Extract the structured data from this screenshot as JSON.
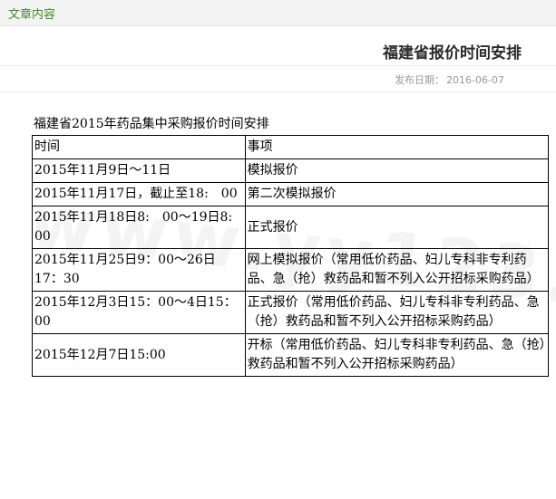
{
  "header": {
    "section_label": "文章内容"
  },
  "article": {
    "title": "福建省报价时间安排",
    "date_label": "发布日期：",
    "date_value": "2016-06-07",
    "heading": "福建省2015年药品集中采购报价时间安排",
    "watermark": "www.yy123.com"
  },
  "table": {
    "headers": [
      "时间",
      "事项"
    ],
    "rows": [
      {
        "time": "2015年11月9日～11日",
        "item": "模拟报价"
      },
      {
        "time": "2015年11月17日，截止至18:　00",
        "item": "第二次模拟报价"
      },
      {
        "time": "2015年11月18日8:　00～19日8:　00",
        "item": "正式报价"
      },
      {
        "time": "2015年11月25日9：00～26日17：30",
        "item": "网上模拟报价（常用低价药品、妇儿专科非专利药品、急（抢）救药品和暂不列入公开招标采购药品）"
      },
      {
        "time": "2015年12月3日15：00～4日15：00",
        "item": "正式报价（常用低价药品、妇儿专科非专利药品、急（抢）救药品和暂不列入公开招标采购药品）"
      },
      {
        "time": "2015年12月7日15:00",
        "item": "开标（常用低价药品、妇儿专科非专利药品、急（抢）救药品和暂不列入公开招标采购药品）"
      }
    ]
  }
}
